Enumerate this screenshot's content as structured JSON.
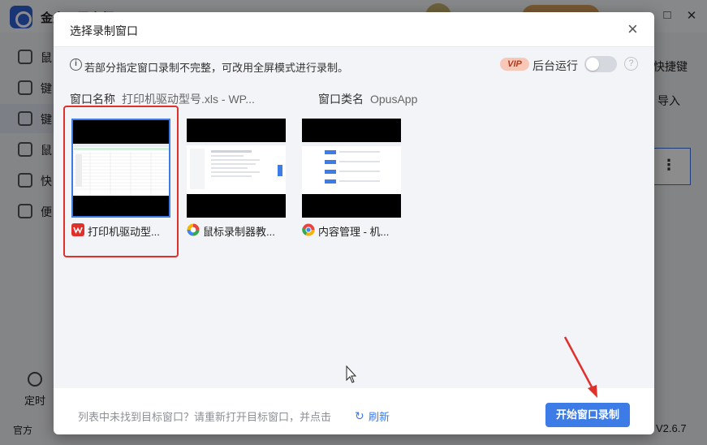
{
  "app": {
    "title": "金舟录屏大师",
    "sidebar": [
      "鼠",
      "键",
      "键",
      "鼠",
      "快",
      "便"
    ],
    "timer_label": "定时",
    "right_label_1": "快捷键",
    "right_label_2": "导入",
    "footer_left": "官方",
    "version": "V2.6.7"
  },
  "dialog": {
    "title": "选择录制窗口",
    "close_glyph": "×",
    "info_text": "若部分指定窗口录制不完整，可改用全屏模式进行录制。",
    "vip_badge": "VIP",
    "background_run_label": "后台运行",
    "background_run_on": false,
    "help_glyph": "?",
    "window_name_label": "窗口名称",
    "window_name_value": "打印机驱动型号.xls - WP...",
    "window_class_label": "窗口类名",
    "window_class_value": "OpusApp",
    "windows": [
      {
        "label": "打印机驱动型...",
        "icon": "wps-icon",
        "selected": true
      },
      {
        "label": "鼠标录制器教...",
        "icon": "colorful-app-icon",
        "selected": false
      },
      {
        "label": "内容管理 - 机...",
        "icon": "chrome-icon",
        "selected": false
      }
    ],
    "footer_hint": "列表中未找到目标窗口？请重新打开目标窗口，并点击",
    "refresh_label": "刷新",
    "start_button": "开始窗口录制"
  },
  "colors": {
    "primary": "#3d7be6",
    "highlight_frame": "#e0302b",
    "arrow": "#e0302b"
  }
}
